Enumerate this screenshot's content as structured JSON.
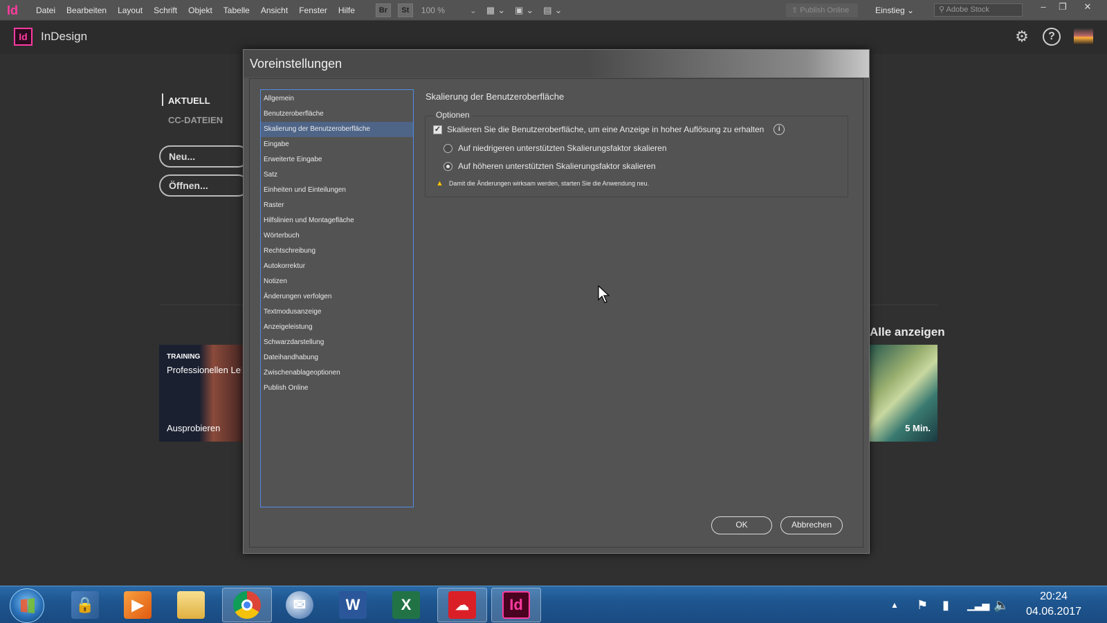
{
  "menubar": {
    "items": [
      "Datei",
      "Bearbeiten",
      "Layout",
      "Schrift",
      "Objekt",
      "Tabelle",
      "Ansicht",
      "Fenster",
      "Hilfe"
    ],
    "bridge": "Br",
    "stock_btn": "St",
    "zoom": "100 %",
    "publish": "Publish Online",
    "workspace": "Einstieg",
    "search_placeholder": "Adobe Stock"
  },
  "app": {
    "logo": "Id",
    "name": "InDesign"
  },
  "start": {
    "nav": [
      "AKTUELL",
      "CC-DATEIEN"
    ],
    "new_btn": "Neu...",
    "open_btn": "Öffnen...",
    "see_all": "Alle anzeigen",
    "card": {
      "tag": "TRAINING",
      "title": "Professionellen Leb",
      "action": "Ausprobieren"
    },
    "right_card_duration": "5 Min."
  },
  "dialog": {
    "title": "Voreinstellungen",
    "categories": [
      "Allgemein",
      "Benutzeroberfläche",
      "Skalierung der Benutzeroberfläche",
      "Eingabe",
      "Erweiterte Eingabe",
      "Satz",
      "Einheiten und Einteilungen",
      "Raster",
      "Hilfslinien und Montagefläche",
      "Wörterbuch",
      "Rechtschreibung",
      "Autokorrektur",
      "Notizen",
      "Änderungen verfolgen",
      "Textmodusanzeige",
      "Anzeigeleistung",
      "Schwarzdarstellung",
      "Dateihandhabung",
      "Zwischenablageoptionen",
      "Publish Online"
    ],
    "selected_index": 2,
    "section_title": "Skalierung der Benutzeroberfläche",
    "group_label": "Optionen",
    "checkbox_label": "Skalieren Sie die Benutzeroberfläche, um eine Anzeige in hoher Auflösung zu erhalten",
    "checkbox_checked": true,
    "radio_low": "Auf niedrigeren unterstützten Skalierungsfaktor skalieren",
    "radio_high": "Auf höheren unterstützten Skalierungsfaktor skalieren",
    "radio_selected": "high",
    "warning": "Damit die Änderungen wirksam werden, starten Sie die Anwendung neu.",
    "ok": "OK",
    "cancel": "Abbrechen"
  },
  "taskbar": {
    "time": "20:24",
    "date": "04.06.2017",
    "apps": [
      "lock-folder-icon",
      "media-player-icon",
      "explorer-icon",
      "chrome-icon",
      "thunderbird-icon",
      "word-icon",
      "excel-icon",
      "creative-cloud-icon",
      "indesign-icon"
    ]
  },
  "colors": {
    "indesign_pink": "#ff3ba0",
    "selection_blue": "#4e6588",
    "list_border": "#4f8de8",
    "warning_yellow": "#f2c200"
  }
}
